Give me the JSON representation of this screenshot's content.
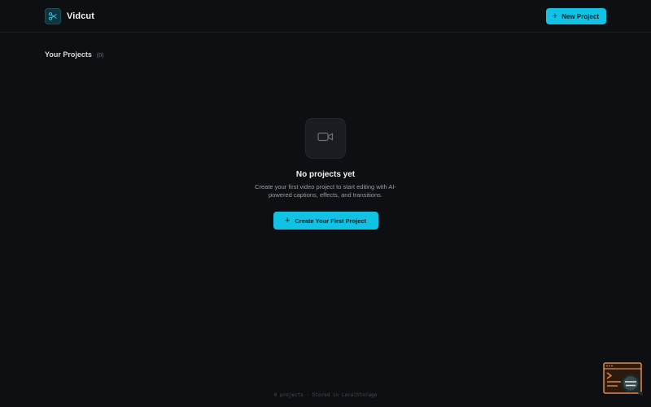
{
  "app": {
    "name": "Vidcut"
  },
  "header": {
    "new_project_label": "New Project"
  },
  "projects": {
    "heading": "Your Projects",
    "count_label": "(0)"
  },
  "empty_state": {
    "title": "No projects yet",
    "description": "Create your first video project to start editing with AI-powered captions, effects, and transitions.",
    "cta_label": "Create Your First Project"
  },
  "footer": {
    "status": "0 projects · Stored in LocalStorage"
  },
  "icons": {
    "logo": "scissors-icon",
    "empty": "video-camera-icon",
    "plus": "plus-icon",
    "helper": "terminal-search-icon"
  },
  "colors": {
    "background": "#0e0f12",
    "accent": "#12c2e4",
    "helper_orange": "#e08a4e"
  }
}
